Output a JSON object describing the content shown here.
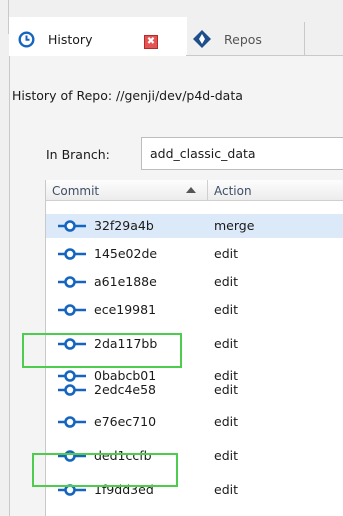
{
  "tabs": {
    "history": {
      "label": "History",
      "close": "✖"
    },
    "repos": {
      "label": "Repos"
    }
  },
  "header": {
    "repo_title": "History of Repo: //genji/dev/p4d-data"
  },
  "branch": {
    "label": "In Branch:",
    "value": "add_classic_data"
  },
  "table": {
    "columns": {
      "commit": "Commit",
      "action": "Action"
    },
    "rows": [
      {
        "commit": "32f29a4b",
        "action": "merge"
      },
      {
        "commit": "145e02de",
        "action": "edit"
      },
      {
        "commit": "a61e188e",
        "action": "edit"
      },
      {
        "commit": "ece19981",
        "action": "edit"
      },
      {
        "commit": "2da117bb",
        "action": "edit"
      },
      {
        "commit": "0babcb01",
        "action": "edit"
      },
      {
        "commit": "2edc4e58",
        "action": "edit"
      },
      {
        "commit": "e76ec710",
        "action": "edit"
      },
      {
        "commit": "ded1ccfb",
        "action": "edit"
      },
      {
        "commit": "1f9dd3ed",
        "action": "edit"
      }
    ]
  },
  "colors": {
    "accent": "#1565c0",
    "highlight": "#4dcc4d",
    "selection": "#dce9f8",
    "close": "#e35454"
  }
}
